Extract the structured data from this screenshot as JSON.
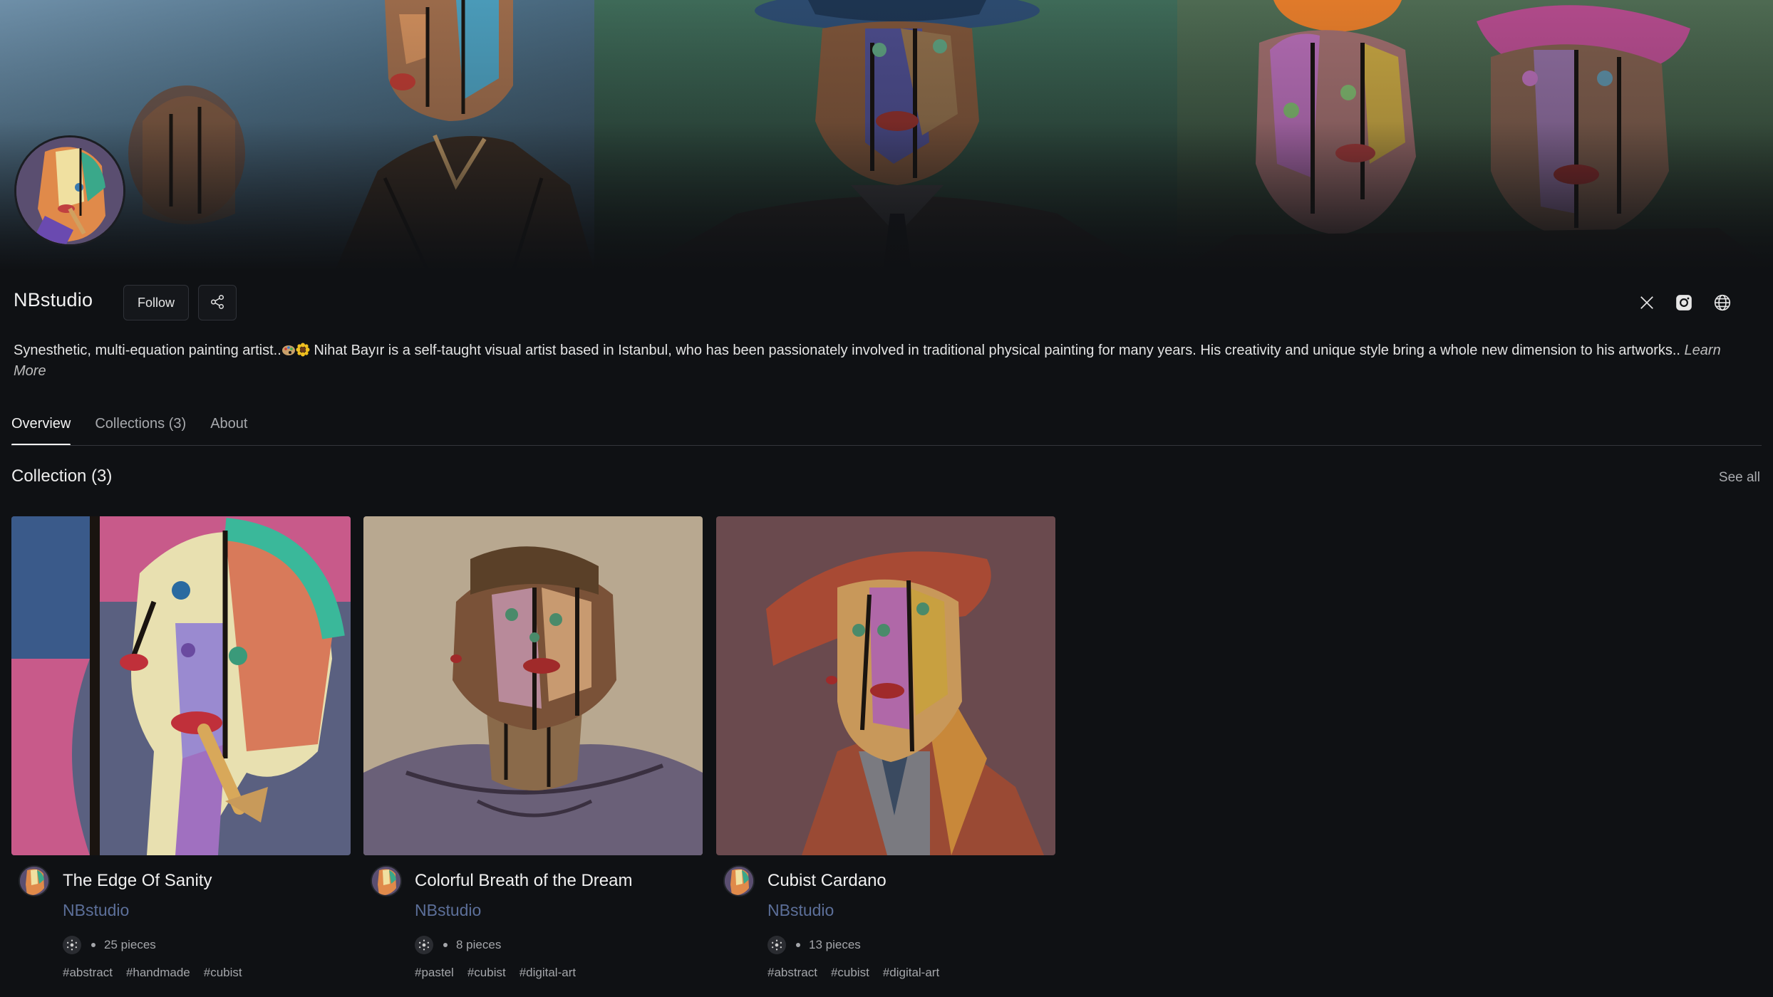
{
  "profile": {
    "name": "NBstudio",
    "follow_label": "Follow",
    "bio_part1": "Synesthetic, multi-equation painting artist..",
    "bio_part2": " Nihat Bayır is a self-taught visual artist based in Istanbul, who has been passionately involved in traditional physical painting for many years. His creativity and unique style bring a whole new dimension to his artworks..",
    "learn_more": "Learn More"
  },
  "icons": {
    "share": "share-icon",
    "x": "x-logo-icon",
    "instagram": "instagram-icon",
    "website": "globe-icon",
    "chain": "blockchain-icon"
  },
  "tabs": [
    {
      "label": "Overview",
      "active": true
    },
    {
      "label": "Collections (3)",
      "active": false
    },
    {
      "label": "About",
      "active": false
    }
  ],
  "section": {
    "title": "Collection (3)",
    "see_all": "See all"
  },
  "collections": [
    {
      "title": "The Edge Of Sanity",
      "creator": "NBstudio",
      "pieces": "25 pieces",
      "tags": [
        "#abstract",
        "#handmade",
        "#cubist"
      ]
    },
    {
      "title": "Colorful Breath of the Dream",
      "creator": "NBstudio",
      "pieces": "8 pieces",
      "tags": [
        "#pastel",
        "#cubist",
        "#digital-art"
      ]
    },
    {
      "title": "Cubist Cardano",
      "creator": "NBstudio",
      "pieces": "13 pieces",
      "tags": [
        "#abstract",
        "#cubist",
        "#digital-art"
      ]
    }
  ],
  "colors": {
    "background": "#0f1114",
    "creator_link": "#5c6f99",
    "muted_text": "#a7a9ad"
  }
}
